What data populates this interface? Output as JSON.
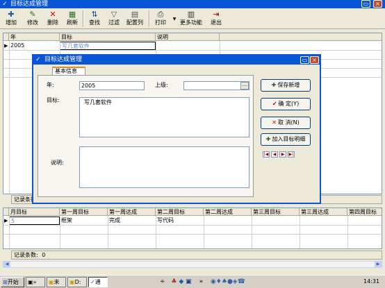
{
  "window": {
    "title": "目标达成管理",
    "close_label": "×"
  },
  "toolbar": {
    "items": [
      {
        "label": "增加",
        "icon": "add-icon"
      },
      {
        "label": "修改",
        "icon": "edit-icon"
      },
      {
        "label": "删除",
        "icon": "delete-icon"
      },
      {
        "label": "刷新",
        "icon": "refresh-icon"
      },
      {
        "label": "查找",
        "icon": "sort-icon"
      },
      {
        "label": "过滤",
        "icon": "filter-icon"
      },
      {
        "label": "配置列",
        "icon": "config-icon"
      },
      {
        "label": "打印",
        "icon": "print-icon"
      },
      {
        "label": "更多功能",
        "icon": "more-icon"
      },
      {
        "label": "退出",
        "icon": "exit-icon"
      }
    ]
  },
  "top_grid": {
    "columns": [
      "年",
      "目标",
      "说明"
    ],
    "rows": [
      {
        "year": "2005",
        "goal": "写几套软件",
        "note": ""
      }
    ]
  },
  "dialog": {
    "title": "目标达成管理",
    "tab": "基本信息",
    "year_label": "年:",
    "year_value": "2005",
    "parent_label": "上级:",
    "parent_value": "",
    "browse": "...",
    "goal_label": "目标:",
    "goal_value": "写几套软件",
    "note_label": "说明:",
    "note_value": "",
    "buttons": {
      "save_new": "保存新增",
      "ok": "确 定(Y)",
      "cancel": "取 消(N)",
      "add_detail": "加入目标明细"
    },
    "nav": [
      "|◀",
      "◀",
      "▶",
      "▶|"
    ]
  },
  "status_top": "记录条数:",
  "bottom_grid": {
    "columns": [
      "月目标",
      "第一周目标",
      "第一周达成",
      "第二周目标",
      "第二周达成",
      "第三周目标",
      "第三周达成",
      "第四周目标"
    ],
    "rows": [
      [
        "5",
        "框架",
        "完成",
        "写代码",
        "",
        "",
        "",
        ""
      ]
    ]
  },
  "status_bottom": {
    "label": "记录条数:",
    "count": "0"
  },
  "taskbar": {
    "start": "开始",
    "tasks": [
      "»",
      "未",
      "D:",
      "通"
    ],
    "clock": "14:31"
  }
}
